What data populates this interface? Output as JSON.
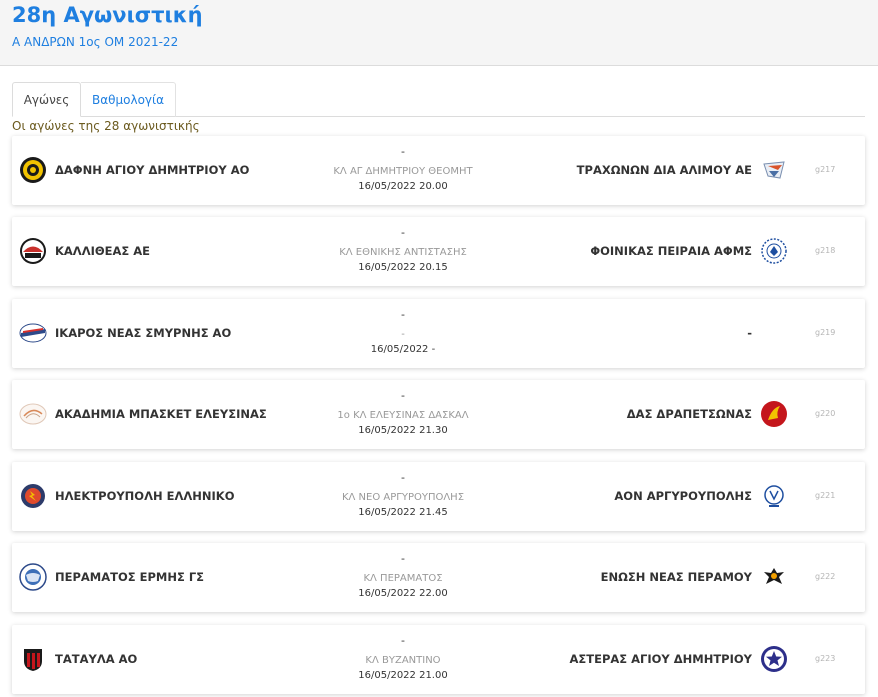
{
  "header": {
    "title": "28η Αγωνιστική",
    "subtitle": "Α ΑΝΔΡΩΝ 1ος ΟΜ 2021-22"
  },
  "tabs": [
    {
      "label": "Αγώνες",
      "active": true
    },
    {
      "label": "Βαθμολογία",
      "active": false
    }
  ],
  "section_label": "Οι αγώνες της 28 αγωνιστικής",
  "colors": {
    "accent": "#1f7fe0",
    "label_text": "#6b5a1e"
  },
  "matches": [
    {
      "home": "ΔΑΦΝΗ ΑΓΙΟΥ ΔΗΜΗΤΡΙΟΥ ΑΟ",
      "away": "ΤΡΑΧΩΝΩΝ ΔΙΑ ΑΛΙΜΟΥ ΑΕ",
      "score": "-",
      "venue": "ΚΛ ΑΓ ΔΗΜΗΤΡΙΟΥ ΘΕΟΜΗΤ",
      "datetime": "16/05/2022 20.00",
      "code": "g217",
      "home_logo_icon": "dafni-crest-icon",
      "away_logo_icon": "trachones-crest-icon"
    },
    {
      "home": "ΚΑΛΛΙΘΕΑΣ ΑΕ",
      "away": "ΦΟΙΝΙΚΑΣ ΠΕΙΡΑΙΑ ΑΦΜΣ",
      "score": "-",
      "venue": "ΚΛ ΕΘΝΙΚΗΣ ΑΝΤΙΣΤΑΣΗΣ",
      "datetime": "16/05/2022 20.15",
      "code": "g218",
      "home_logo_icon": "kallithea-crest-icon",
      "away_logo_icon": "foinikas-crest-icon"
    },
    {
      "home": "ΙΚΑΡΟΣ ΝΕΑΣ ΣΜΥΡΝΗΣ ΑΟ",
      "away": "-",
      "score": "-",
      "venue": "-",
      "datetime": "16/05/2022 -",
      "code": "g219",
      "home_logo_icon": "ikaros-crest-icon",
      "away_logo_icon": ""
    },
    {
      "home": "ΑΚΑΔΗΜΙΑ ΜΠΑΣΚΕΤ ΕΛΕΥΣΙΝΑΣ",
      "away": "ΔΑΣ ΔΡΑΠΕΤΣΩΝΑΣ",
      "score": "-",
      "venue": "1ο ΚΛ ΕΛΕΥΣΙΝΑΣ ΔΑΣΚΑΛ",
      "datetime": "16/05/2022 21.30",
      "code": "g220",
      "home_logo_icon": "akadimia-crest-icon",
      "away_logo_icon": "drapetsona-crest-icon"
    },
    {
      "home": "ΗΛΕΚΤΡΟΥΠΟΛΗ ΕΛΛΗΝΙΚΟ",
      "away": "ΑΟΝ ΑΡΓΥΡΟΥΠΟΛΗΣ",
      "score": "-",
      "venue": "ΚΛ ΝΕΟ ΑΡΓΥΡΟΥΠΟΛΗΣ",
      "datetime": "16/05/2022 21.45",
      "code": "g221",
      "home_logo_icon": "ilektroupoli-crest-icon",
      "away_logo_icon": "aon-crest-icon"
    },
    {
      "home": "ΠΕΡΑΜΑΤΟΣ ΕΡΜΗΣ ΓΣ",
      "away": "ΕΝΩΣΗ ΝΕΑΣ ΠΕΡΑΜΟΥ",
      "score": "-",
      "venue": "ΚΛ ΠΕΡΑΜΑΤΟΣ",
      "datetime": "16/05/2022 22.00",
      "code": "g222",
      "home_logo_icon": "ermis-crest-icon",
      "away_logo_icon": "enosi-eagle-icon"
    },
    {
      "home": "ΤΑΤΑΥΛΑ ΑΟ",
      "away": "ΑΣΤΕΡΑΣ ΑΓΙΟΥ ΔΗΜΗΤΡΙΟΥ",
      "score": "-",
      "venue": "ΚΛ ΒΥΖΑΝΤΙΝΟ",
      "datetime": "16/05/2022 21.00",
      "code": "g223",
      "home_logo_icon": "tatavla-crest-icon",
      "away_logo_icon": "asteras-star-icon"
    }
  ]
}
